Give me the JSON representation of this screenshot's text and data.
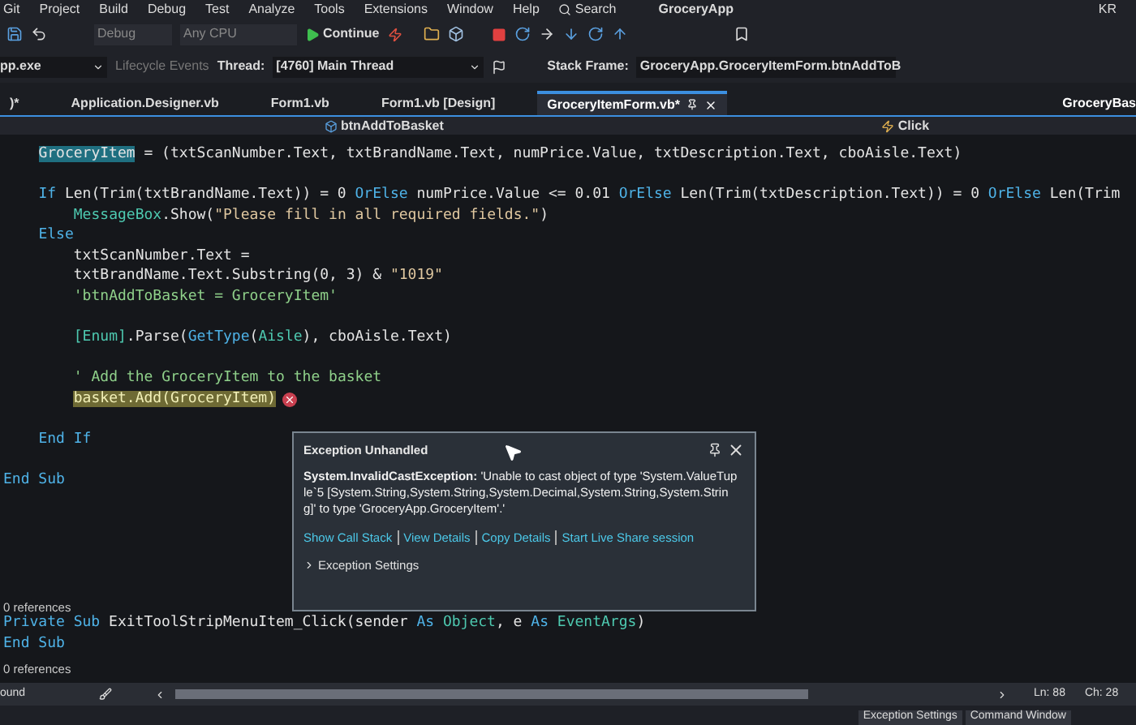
{
  "menu_bar": {
    "items": [
      "Git",
      "Project",
      "Build",
      "Debug",
      "Test",
      "Analyze",
      "Tools",
      "Extensions",
      "Window",
      "Help"
    ],
    "search": "Search",
    "app_name": "GroceryApp",
    "user_initials": "KR"
  },
  "toolbar": {
    "configuration": "Debug",
    "platform": "Any CPU",
    "continue_button": "Continue"
  },
  "debug_location": {
    "process": "pp.exe",
    "lifecycle_events": "Lifecycle Events",
    "thread_label": "Thread:",
    "thread": "[4760] Main Thread",
    "stack_frame_label": "Stack Frame:",
    "stack_frame": "GroceryApp.GroceryItemForm.btnAddToB"
  },
  "tabs": [
    {
      "label": ")*",
      "selected": false
    },
    {
      "label": "Application.Designer.vb",
      "selected": false
    },
    {
      "label": "Form1.vb",
      "selected": false
    },
    {
      "label": "Form1.vb [Design]",
      "selected": false
    },
    {
      "label": "GroceryItemForm.vb*",
      "selected": true
    }
  ],
  "right_tab": "GroceryBas",
  "navigation_bar": {
    "member": "btnAddToBasket",
    "event": "Click"
  },
  "code_lines": [
    {
      "kind": "block",
      "children": [
        {
          "kind": "code",
          "segments": [
            {
              "text": "GroceryItem",
              "kind": "highlight"
            },
            {
              "text": " = (txtScanNumber.Text, txtBrandName.Text, numPrice.Value, txtDescription.Text, cboAisle.Text)",
              "kind": "plain"
            }
          ]
        },
        {
          "kind": "blank"
        },
        {
          "kind": "code",
          "segments": [
            {
              "text": "If ",
              "kind": "keyword"
            },
            {
              "text": "Len(Trim(txtBrandName.Text)) = 0 ",
              "kind": "plain"
            },
            {
              "text": "OrElse",
              "kind": "keyword"
            },
            {
              "text": " numPrice.Value <= 0.01 ",
              "kind": "plain"
            },
            {
              "text": "OrElse",
              "kind": "keyword"
            },
            {
              "text": " Len(Trim(txtDescription.Text)) = 0 ",
              "kind": "plain"
            },
            {
              "text": "OrElse",
              "kind": "keyword"
            },
            {
              "text": " Len(Trim",
              "kind": "plain"
            }
          ],
          "children": [
            {
              "kind": "code",
              "segments": [
                {
                  "text": "MessageBox",
                  "kind": "type"
                },
                {
                  "text": ".Show(",
                  "kind": "plain"
                },
                {
                  "text": "\"Please fill in all required fields.\"",
                  "kind": "string"
                },
                {
                  "text": ")",
                  "kind": "plain"
                }
              ]
            }
          ]
        },
        {
          "kind": "code",
          "segments": [
            {
              "text": "Else",
              "kind": "keyword"
            }
          ],
          "children": [
            {
              "kind": "code",
              "segments": [
                {
                  "text": "txtScanNumber.Text =",
                  "kind": "plain"
                }
              ]
            },
            {
              "kind": "code",
              "segments": [
                {
                  "text": "txtBrandName.Text.Substring(0, 3) & ",
                  "kind": "plain"
                },
                {
                  "text": "\"1019\"",
                  "kind": "string"
                }
              ]
            },
            {
              "kind": "code",
              "segments": [
                {
                  "text": "'btnAddToBasket = GroceryItem'",
                  "kind": "comment"
                }
              ]
            },
            {
              "kind": "blank"
            },
            {
              "kind": "code",
              "segments": [
                {
                  "text": "[Enum]",
                  "kind": "type"
                },
                {
                  "text": ".Parse(",
                  "kind": "plain"
                },
                {
                  "text": "GetType",
                  "kind": "keyword"
                },
                {
                  "text": "(",
                  "kind": "plain"
                },
                {
                  "text": "Aisle",
                  "kind": "type"
                },
                {
                  "text": "), cboAisle.Text)",
                  "kind": "plain"
                }
              ]
            },
            {
              "kind": "blank"
            },
            {
              "kind": "code",
              "segments": [
                {
                  "text": "' Add the GroceryItem to the basket",
                  "kind": "comment"
                }
              ]
            },
            {
              "kind": "code",
              "error": true,
              "segments": [
                {
                  "text": "basket.Add(GroceryItem)",
                  "kind": "current"
                }
              ]
            },
            {
              "kind": "blank"
            }
          ]
        },
        {
          "kind": "code",
          "segments": [
            {
              "text": "End If",
              "kind": "keyword"
            }
          ]
        },
        {
          "kind": "blank"
        }
      ]
    },
    {
      "kind": "code",
      "segments": [
        {
          "text": "End Sub",
          "kind": "keyword"
        }
      ]
    },
    {
      "kind": "blank"
    },
    {
      "kind": "blank"
    },
    {
      "kind": "blank"
    },
    {
      "kind": "blank"
    },
    {
      "kind": "blank"
    },
    {
      "kind": "codelens",
      "text": "0 references"
    },
    {
      "kind": "code",
      "segments": [
        {
          "text": "Private Sub ",
          "kind": "keyword"
        },
        {
          "text": "ExitToolStripMenuItem_Click(sender ",
          "kind": "plain"
        },
        {
          "text": "As ",
          "kind": "keyword"
        },
        {
          "text": "Object",
          "kind": "type"
        },
        {
          "text": ", e ",
          "kind": "plain"
        },
        {
          "text": "As ",
          "kind": "keyword"
        },
        {
          "text": "EventArgs",
          "kind": "type"
        },
        {
          "text": ")",
          "kind": "plain"
        }
      ]
    },
    {
      "kind": "code",
      "segments": [
        {
          "text": "End Sub",
          "kind": "keyword"
        }
      ]
    },
    {
      "kind": "codelens",
      "text": "0 references"
    }
  ],
  "exception_popup": {
    "title": "Exception Unhandled",
    "message": "**System.InvalidCastException:** 'Unable to cast object of type 'System.ValueTuple`5 [System.String,System.String,System.Decimal,System.String,System.String]' to type 'GroceryApp.GroceryItem'.'",
    "links": [
      "Show Call Stack",
      "View Details",
      "Copy Details",
      "Start Live Share session"
    ],
    "settings": {
      "label": "Exception Settings",
      "expanded": false
    }
  },
  "status_bar": {
    "find_label": "ound",
    "line": "Ln: 88",
    "column": "Ch: 28"
  },
  "bottom_tabs": [
    "Exception Settings",
    "Command Window"
  ]
}
